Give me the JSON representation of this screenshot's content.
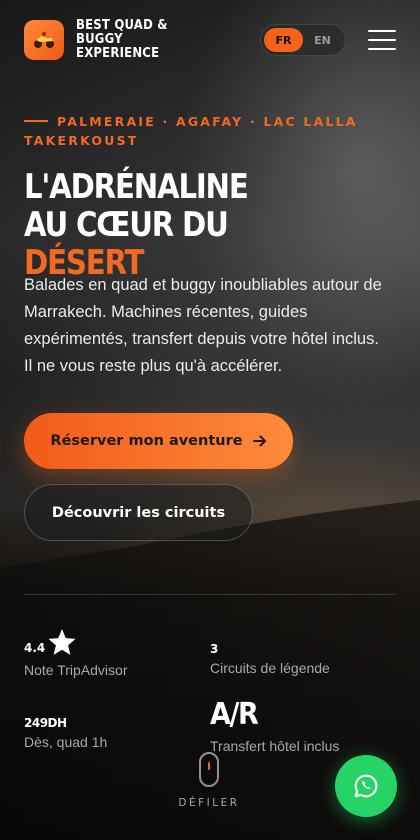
{
  "header": {
    "brand": "BEST QUAD & BUGGY EXPERIENCE",
    "lang_active": "FR",
    "lang_inactive": "EN"
  },
  "hero": {
    "eyebrow": "PALMERAIE · AGAFAY · LAC LALLA TAKERKOUST",
    "title_line1": "L'ADRÉNALINE",
    "title_line2_prefix": "AU CŒUR DU ",
    "title_line2_accent": "DÉSERT",
    "intro": "Balades en quad et buggy inoubliables autour de Marrakech. Machines récentes, guides expérimentés, transfert depuis votre hôtel inclus. Il ne vous reste plus qu'à accélérer.",
    "primary_cta": "Réserver mon aventure",
    "secondary_cta": "Découvrir les circuits"
  },
  "stats": [
    {
      "value": "4.4",
      "label": "Note TripAdvisor"
    },
    {
      "value": "3",
      "label": "Circuits de légende"
    },
    {
      "value": "249DH",
      "label": "Dès, quad 1h"
    },
    {
      "value": "A/R",
      "label": "Transfert hôtel inclus"
    }
  ],
  "scroll_label": "DÉFILER",
  "colors": {
    "accent": "#f26a21",
    "whatsapp": "#25d366"
  },
  "icons": {
    "logo": "quad-bike-logo-icon",
    "menu": "hamburger-menu-icon",
    "cta_arrow": "arrow-right-icon",
    "rating": "star-icon",
    "scroll": "mouse-scroll-icon",
    "chat": "whatsapp-icon"
  }
}
